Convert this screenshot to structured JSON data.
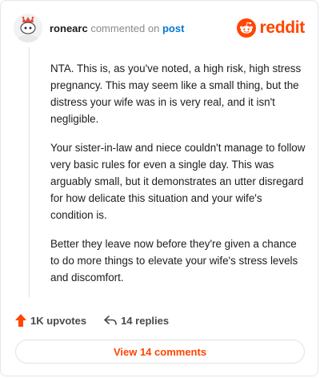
{
  "comment": {
    "username": "ronearc",
    "action_text": "commented on",
    "post_link": "post",
    "paragraphs": [
      "NTA. This is, as you've noted, a high risk, high stress pregnancy. This may seem like a small thing, but the distress your wife was in is very real, and it isn't negligible.",
      "Your sister-in-law and niece couldn't manage to follow very basic rules for even a single day. This was arguably small, but it demonstrates an utter disregard for how delicate this situation and your wife's condition is.",
      "Better they leave now before they're given a chance to do more things to elevate your wife's stress levels and discomfort."
    ],
    "upvotes_label": "1K upvotes",
    "replies_label": "14 replies",
    "view_comments_label": "View 14 comments"
  },
  "brand": {
    "wordmark": "reddit",
    "accent_color": "#ff4500",
    "icon": "reddit-snoo-icon"
  },
  "colors": {
    "link": "#0079d3",
    "text": "#1c1c1c",
    "muted": "#878a8c"
  }
}
